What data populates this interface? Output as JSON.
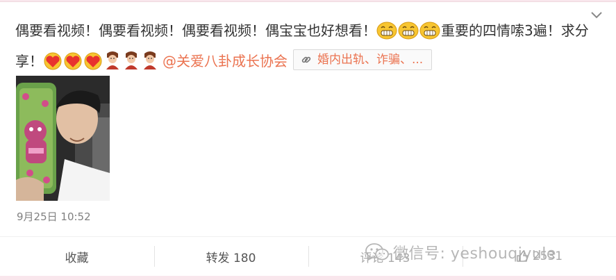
{
  "post": {
    "text_part1": "偶要看视频！偶要看视频！偶要看视频！偶宝宝也好想看！",
    "text_part2": "重要的四情嗦3遍！求分享！",
    "emoji_row1": [
      "grinning-face-icon",
      "grinning-face-icon",
      "grinning-face-icon"
    ],
    "emoji_row2": [
      "heart-face-icon",
      "heart-face-icon",
      "heart-face-icon",
      "cartoon-figure-icon",
      "cartoon-figure-icon",
      "cartoon-figure-icon"
    ],
    "mention": "@关爱八卦成长协会",
    "topic_chip": "婚内出轨、诈骗、..."
  },
  "meta": {
    "timestamp": "9月25日 10:52"
  },
  "actions": {
    "favorite": "收藏",
    "repost": "转发 180",
    "comment": "评论 143",
    "like": "2531"
  },
  "watermark": {
    "text": "微信号: yeshouqiyule"
  },
  "colors": {
    "accent": "#eb7350",
    "page_background": "#f9e6ec",
    "text": "#333333",
    "muted": "#808080"
  }
}
